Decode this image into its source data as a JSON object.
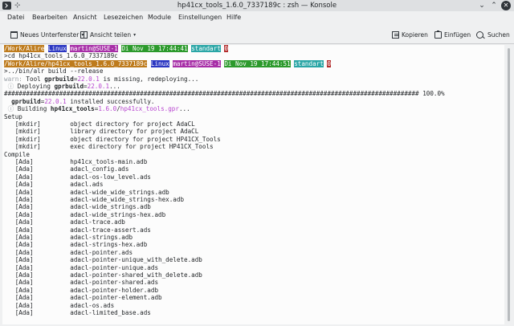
{
  "window": {
    "title": "hp41cx_tools_1.6.0_7337189c : zsh — Konsole",
    "pin_glyph": "⊹",
    "minimize_glyph": "⌄",
    "maximize_glyph": "⌃",
    "close_glyph": "✕"
  },
  "menu": {
    "items": [
      "Datei",
      "Bearbeiten",
      "Ansicht",
      "Lesezeichen",
      "Module",
      "Einstellungen",
      "Hilfe"
    ]
  },
  "toolbar": {
    "new_tab": "Neues Unterfenster",
    "split_view": "Ansicht teilen",
    "copy": "Kopieren",
    "paste": "Einfügen",
    "find": "Suchen",
    "caret": "▾"
  },
  "colors": {
    "prompt_dir": "#be7b1c",
    "prompt_os": "#2b37c2",
    "prompt_user": "#a72ea7",
    "prompt_date": "#2c9a2c",
    "prompt_env": "#2aa6a6",
    "prompt_code": "#b32c2c",
    "version_text": "#b744cf"
  },
  "terminal": {
    "lines": [
      [
        {
          "t": "/Work/Alire",
          "c": "p-dir"
        },
        {
          "t": " "
        },
        {
          "t": "Linux",
          "c": "p-os"
        },
        {
          "t": " "
        },
        {
          "t": "martin@SUSE-1",
          "c": "p-user"
        },
        {
          "t": " "
        },
        {
          "t": "Di Nov 19 17:44:41",
          "c": "p-date"
        },
        {
          "t": " "
        },
        {
          "t": "standart",
          "c": "p-env"
        },
        {
          "t": " "
        },
        {
          "t": "0",
          "c": "p-code"
        }
      ],
      [
        {
          "t": ">cd hp41cx_tools_1.6.0_7337189c"
        }
      ],
      [
        {
          "t": "/Work/Alire/hp41cx_tools_1.6.0_7337189c",
          "c": "p-dir"
        },
        {
          "t": " "
        },
        {
          "t": "Linux",
          "c": "p-os"
        },
        {
          "t": " "
        },
        {
          "t": "martin@SUSE-1",
          "c": "p-user"
        },
        {
          "t": " "
        },
        {
          "t": "Di Nov 19 17:44:51",
          "c": "p-date"
        },
        {
          "t": " "
        },
        {
          "t": "standart",
          "c": "p-env"
        },
        {
          "t": " "
        },
        {
          "t": "0",
          "c": "p-code"
        }
      ],
      [
        {
          "t": ">../bin/alr build --release"
        }
      ],
      [
        {
          "t": "warn:",
          "c": "c-gray"
        },
        {
          "t": " Tool "
        },
        {
          "t": "gprbuild",
          "c": "c-bold"
        },
        {
          "t": "="
        },
        {
          "t": "22.0.1",
          "c": "c-mag"
        },
        {
          "t": " is missing, redeploying..."
        }
      ],
      [
        {
          "t": " "
        },
        {
          "t": "ⓘ",
          "c": "c-gray"
        },
        {
          "t": " Deploying "
        },
        {
          "t": "gprbuild",
          "c": "c-bold"
        },
        {
          "t": "="
        },
        {
          "t": "22.0.1",
          "c": "c-mag"
        },
        {
          "t": "..."
        }
      ],
      [
        {
          "t": "################################################################################################################# 100.0%"
        }
      ],
      [
        {
          "t": "  "
        },
        {
          "t": "gprbuild",
          "c": "c-bold"
        },
        {
          "t": "="
        },
        {
          "t": "22.0.1",
          "c": "c-mag"
        },
        {
          "t": " installed successfully."
        }
      ],
      [
        {
          "t": " "
        },
        {
          "t": "ⓘ",
          "c": "c-gray"
        },
        {
          "t": " Building "
        },
        {
          "t": "hp41cx_tools",
          "c": "c-bold"
        },
        {
          "t": "="
        },
        {
          "t": "1.6.0",
          "c": "c-mag"
        },
        {
          "t": "/"
        },
        {
          "t": "hp41cx_tools.gpr",
          "c": "c-mag"
        },
        {
          "t": "..."
        }
      ],
      [
        {
          "t": "Setup"
        }
      ],
      [
        {
          "t": "   [mkdir]        object directory for project AdaCL"
        }
      ],
      [
        {
          "t": "   [mkdir]        library directory for project AdaCL"
        }
      ],
      [
        {
          "t": "   [mkdir]        object directory for project HP41CX_Tools"
        }
      ],
      [
        {
          "t": "   [mkdir]        exec directory for project HP41CX_Tools"
        }
      ],
      [
        {
          "t": "Compile"
        }
      ],
      [
        {
          "t": "   [Ada]          hp41cx_tools-main.adb"
        }
      ],
      [
        {
          "t": "   [Ada]          adacl_config.ads"
        }
      ],
      [
        {
          "t": "   [Ada]          adacl-os-low_level.ads"
        }
      ],
      [
        {
          "t": "   [Ada]          adacl.ads"
        }
      ],
      [
        {
          "t": "   [Ada]          adacl-wide_wide_strings.adb"
        }
      ],
      [
        {
          "t": "   [Ada]          adacl-wide_wide_strings-hex.adb"
        }
      ],
      [
        {
          "t": "   [Ada]          adacl-wide_strings.adb"
        }
      ],
      [
        {
          "t": "   [Ada]          adacl-wide_strings-hex.adb"
        }
      ],
      [
        {
          "t": "   [Ada]          adacl-trace.adb"
        }
      ],
      [
        {
          "t": "   [Ada]          adacl-trace-assert.ads"
        }
      ],
      [
        {
          "t": "   [Ada]          adacl-strings.adb"
        }
      ],
      [
        {
          "t": "   [Ada]          adacl-strings-hex.adb"
        }
      ],
      [
        {
          "t": "   [Ada]          adacl-pointer.ads"
        }
      ],
      [
        {
          "t": "   [Ada]          adacl-pointer-unique_with_delete.adb"
        }
      ],
      [
        {
          "t": "   [Ada]          adacl-pointer-unique.ads"
        }
      ],
      [
        {
          "t": "   [Ada]          adacl-pointer-shared_with_delete.adb"
        }
      ],
      [
        {
          "t": "   [Ada]          adacl-pointer-shared.ads"
        }
      ],
      [
        {
          "t": "   [Ada]          adacl-pointer-holder.adb"
        }
      ],
      [
        {
          "t": "   [Ada]          adacl-pointer-element.adb"
        }
      ],
      [
        {
          "t": "   [Ada]          adacl-os.ads"
        }
      ],
      [
        {
          "t": "   [Ada]          adacl-limited_base.ads"
        }
      ]
    ]
  }
}
